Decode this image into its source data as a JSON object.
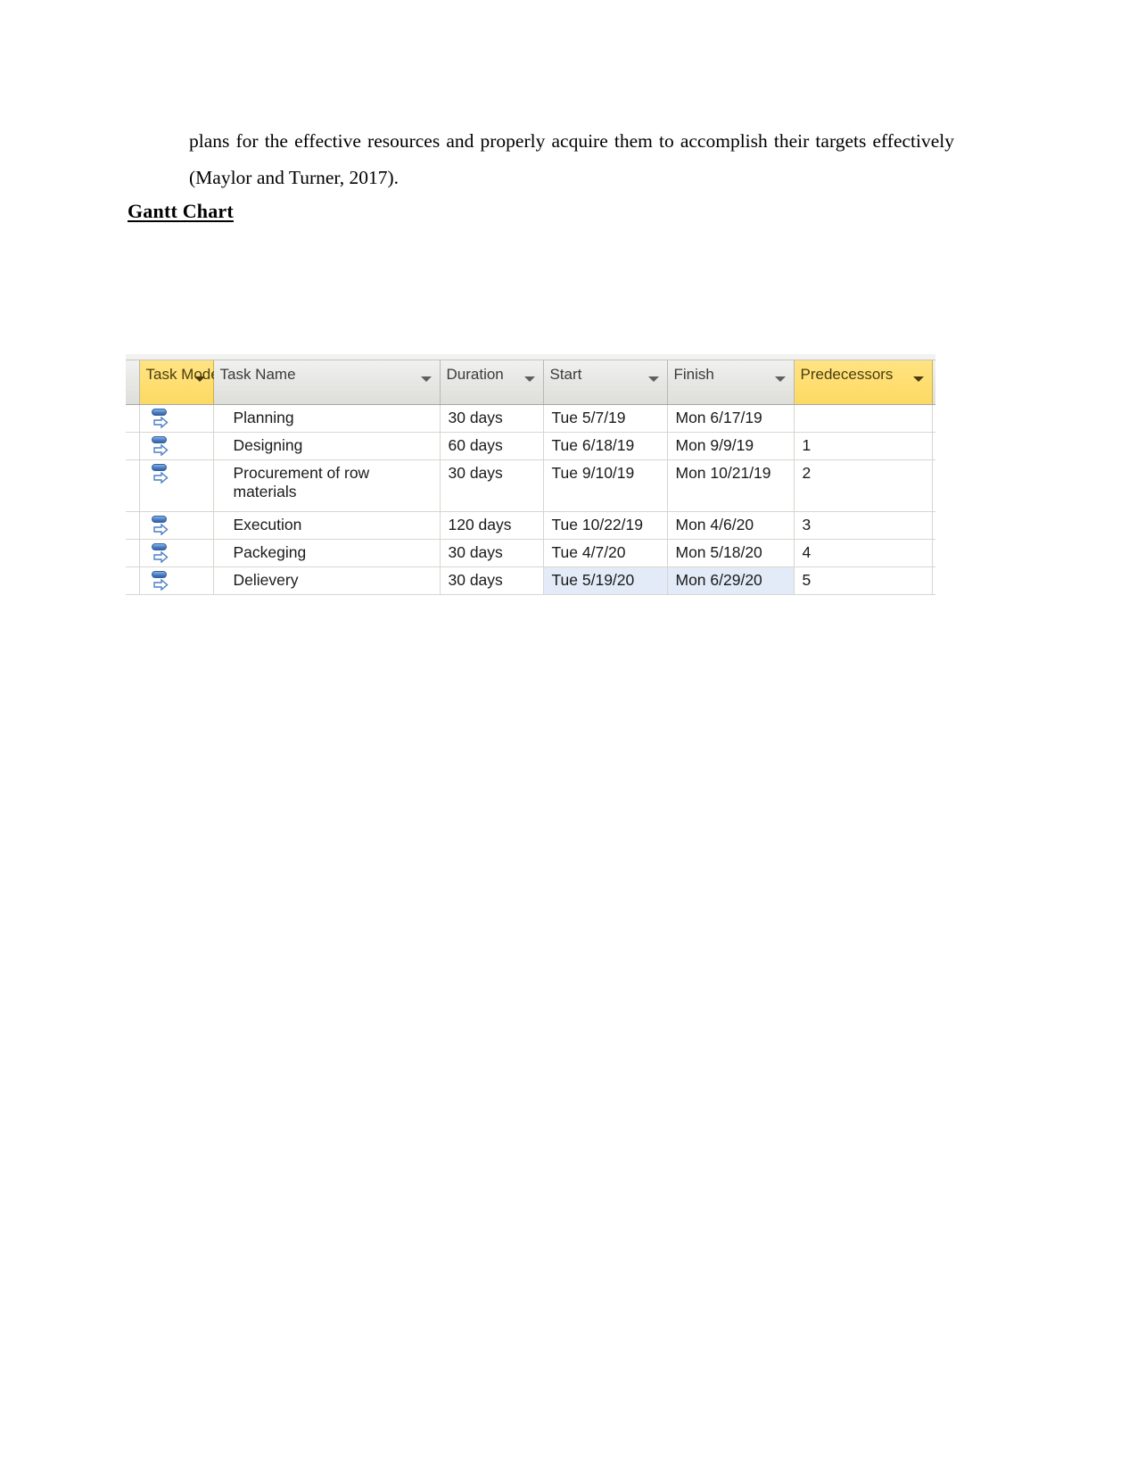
{
  "document": {
    "paragraph": "plans for the effective resources and properly acquire them to accomplish their targets effectively (Maylor and Turner, 2017).",
    "heading": "Gantt Chart"
  },
  "gantt": {
    "columns": [
      {
        "label": "Task Mode",
        "highlight": true,
        "filter": true
      },
      {
        "label": "Task Name",
        "highlight": false,
        "filter": true
      },
      {
        "label": "Duration",
        "highlight": false,
        "filter": true
      },
      {
        "label": "Start",
        "highlight": false,
        "filter": true
      },
      {
        "label": "Finish",
        "highlight": false,
        "filter": true
      },
      {
        "label": "Predecessors",
        "highlight": true,
        "filter": true
      }
    ],
    "rows": [
      {
        "mode_icon": "manually-scheduled-task-icon",
        "task_name": "Planning",
        "duration": "30 days",
        "start": "Tue 5/7/19",
        "finish": "Mon 6/17/19",
        "predecessors": "",
        "selected": false
      },
      {
        "mode_icon": "manually-scheduled-task-icon",
        "task_name": "Designing",
        "duration": "60 days",
        "start": "Tue 6/18/19",
        "finish": "Mon 9/9/19",
        "predecessors": "1",
        "selected": false
      },
      {
        "mode_icon": "manually-scheduled-task-icon",
        "task_name": "Procurement of row materials",
        "duration": "30 days",
        "start": "Tue 9/10/19",
        "finish": "Mon 10/21/19",
        "predecessors": "2",
        "selected": false
      },
      {
        "mode_icon": "manually-scheduled-task-icon",
        "task_name": "Execution",
        "duration": "120 days",
        "start": "Tue 10/22/19",
        "finish": "Mon 4/6/20",
        "predecessors": "3",
        "selected": false
      },
      {
        "mode_icon": "manually-scheduled-task-icon",
        "task_name": "Packeging",
        "duration": "30 days",
        "start": "Tue 4/7/20",
        "finish": "Mon 5/18/20",
        "predecessors": "4",
        "selected": false
      },
      {
        "mode_icon": "manually-scheduled-task-icon",
        "task_name": "Delievery",
        "duration": "30 days",
        "start": "Tue 5/19/20",
        "finish": "Mon 6/29/20",
        "predecessors": "5",
        "selected": true
      }
    ],
    "colors": {
      "header_highlight": "#ffdf72",
      "header_normal": "#e6e6e3",
      "selection": "#e2ebf7",
      "icon_blue": "#4a7ec4",
      "grid_line": "#d6d6d0"
    }
  }
}
